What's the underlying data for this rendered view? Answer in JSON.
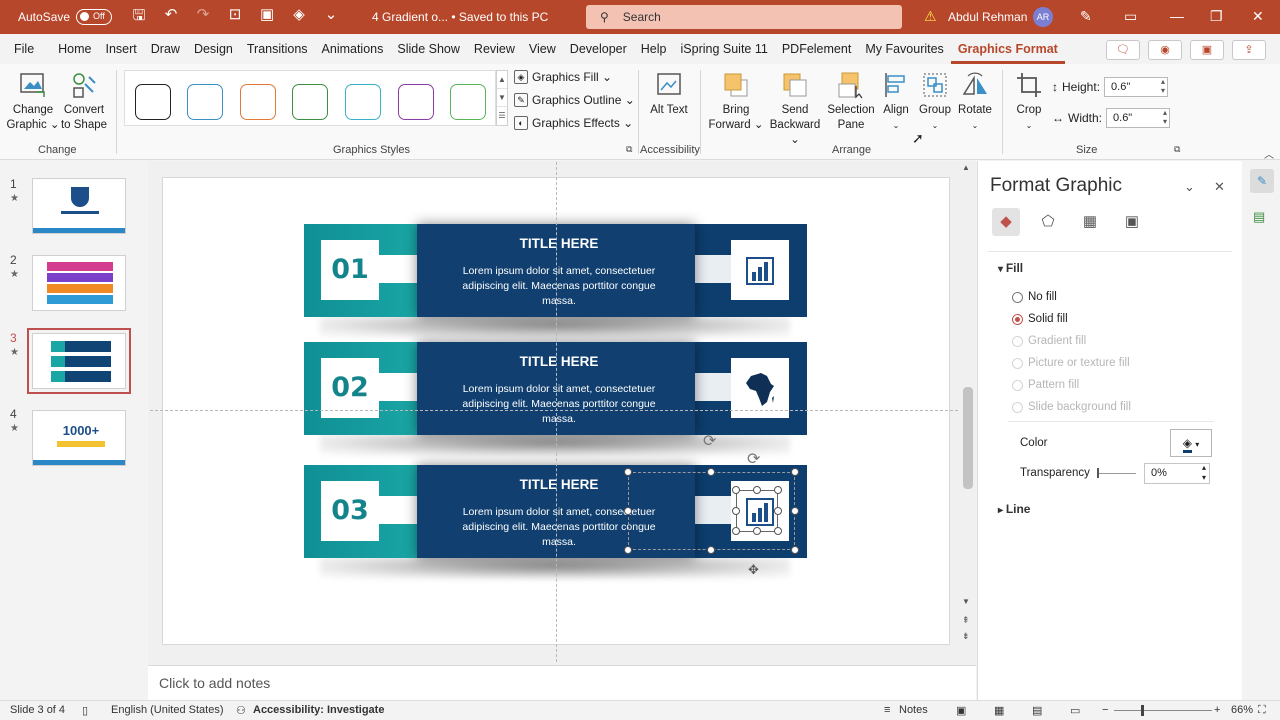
{
  "titlebar": {
    "autosave_label": "AutoSave",
    "autosave_state": "Off",
    "doc_title": "4 Gradient o...  •  Saved to this PC",
    "search_placeholder": "Search",
    "user_name": "Abdul Rehman",
    "user_initials": "AR",
    "accent_color": "#b7472a"
  },
  "menu": {
    "tabs": [
      "File",
      "Home",
      "Insert",
      "Draw",
      "Design",
      "Transitions",
      "Animations",
      "Slide Show",
      "Review",
      "View",
      "Developer",
      "Help",
      "iSpring Suite 11",
      "PDFelement",
      "My Favourites",
      "Graphics Format"
    ],
    "active_tab": "Graphics Format"
  },
  "ribbon": {
    "change_graphic": "Change Graphic ⌄",
    "convert_to_shape": "Convert to Shape",
    "group_change": "Change",
    "group_graphics_styles": "Graphics Styles",
    "graphics_fill": "Graphics Fill ⌄",
    "graphics_outline": "Graphics Outline ⌄",
    "graphics_effects": "Graphics Effects ⌄",
    "alt_text": "Alt Text",
    "group_accessibility": "Accessibility",
    "bring_forward": "Bring Forward ⌄",
    "send_backward": "Send Backward ⌄",
    "selection_pane": "Selection Pane",
    "align": "Align",
    "group": "Group",
    "rotate": "Rotate",
    "group_arrange": "Arrange",
    "crop": "Crop",
    "height_label": "Height:",
    "height_value": "0.6\"",
    "width_label": "Width:",
    "width_value": "0.6\"",
    "group_size": "Size",
    "style_swatches": [
      "#222222",
      "#3a8fc4",
      "#e07b39",
      "#3e8e41",
      "#3ab0c9",
      "#8e3aa6",
      "#5bb55b"
    ]
  },
  "thumbnails": [
    {
      "num": "1",
      "star": "★"
    },
    {
      "num": "2",
      "star": "★"
    },
    {
      "num": "3",
      "star": "★"
    },
    {
      "num": "4",
      "star": "★"
    }
  ],
  "thumb4_text": "1000+",
  "slide": {
    "rows": [
      {
        "number": "01",
        "title": "TITLE HERE",
        "body": "Lorem ipsum dolor sit amet, consectetuer adipiscing elit. Maecenas porttitor congue massa.",
        "icon": "bar-chart-icon"
      },
      {
        "number": "02",
        "title": "TITLE HERE",
        "body": "Lorem ipsum dolor sit amet, consectetuer adipiscing elit. Maecenas porttitor congue massa.",
        "icon": "africa-map-icon"
      },
      {
        "number": "03",
        "title": "TITLE HERE",
        "body": "Lorem ipsum dolor sit amet, consectetuer adipiscing elit. Maecenas porttitor congue massa.",
        "icon": "bar-chart-icon"
      }
    ],
    "teal": "#1aa6a5",
    "navy": "#103f70"
  },
  "pane": {
    "title": "Format Graphic",
    "fill_section": "Fill",
    "fill_options": [
      {
        "label": "No fill",
        "state": "enabled"
      },
      {
        "label": "Solid fill",
        "state": "selected"
      },
      {
        "label": "Gradient fill",
        "state": "disabled"
      },
      {
        "label": "Picture or texture fill",
        "state": "disabled"
      },
      {
        "label": "Pattern fill",
        "state": "disabled"
      },
      {
        "label": "Slide background fill",
        "state": "disabled"
      }
    ],
    "color_label": "Color",
    "transparency_label": "Transparency",
    "transparency_value": "0%",
    "line_section": "Line"
  },
  "notes_placeholder": "Click to add notes",
  "status": {
    "slide_info": "Slide 3 of 4",
    "language": "English (United States)",
    "accessibility": "Accessibility: Investigate",
    "notes": "Notes",
    "zoom": "66%"
  }
}
